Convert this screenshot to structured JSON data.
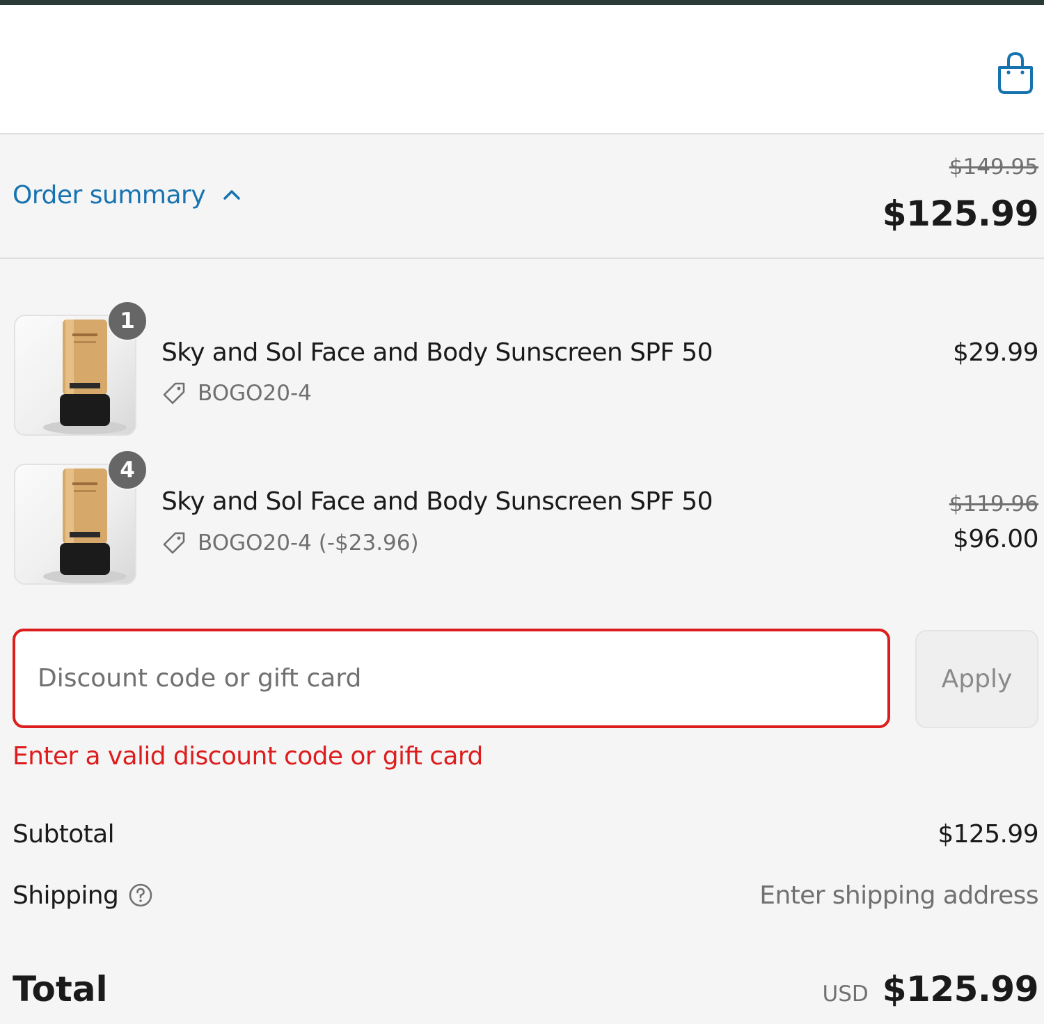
{
  "header": {
    "cart_icon": "shopping-bag-icon"
  },
  "summary": {
    "toggle_label": "Order summary",
    "toggle_icon": "chevron-up-icon",
    "compare_total": "$149.95",
    "total": "$125.99"
  },
  "items": [
    {
      "quantity": "1",
      "title": "Sky and Sol Face and Body Sunscreen SPF 50",
      "discount": "BOGO20-4",
      "compare_price": "",
      "price": "$29.99"
    },
    {
      "quantity": "4",
      "title": "Sky and Sol Face and Body Sunscreen SPF 50",
      "discount": "BOGO20-4 (-$23.96)",
      "compare_price": "$119.96",
      "price": "$96.00"
    }
  ],
  "discount": {
    "placeholder": "Discount code or gift card",
    "value": "",
    "apply_label": "Apply",
    "error": "Enter a valid discount code or gift card"
  },
  "totals": {
    "subtotal_label": "Subtotal",
    "subtotal_value": "$125.99",
    "shipping_label": "Shipping",
    "shipping_value": "Enter shipping address",
    "total_label": "Total",
    "currency": "USD",
    "total_value": "$125.99"
  },
  "colors": {
    "accent": "#1773b0",
    "error": "#dd1d1d",
    "top_strip": "#2a3a36"
  }
}
